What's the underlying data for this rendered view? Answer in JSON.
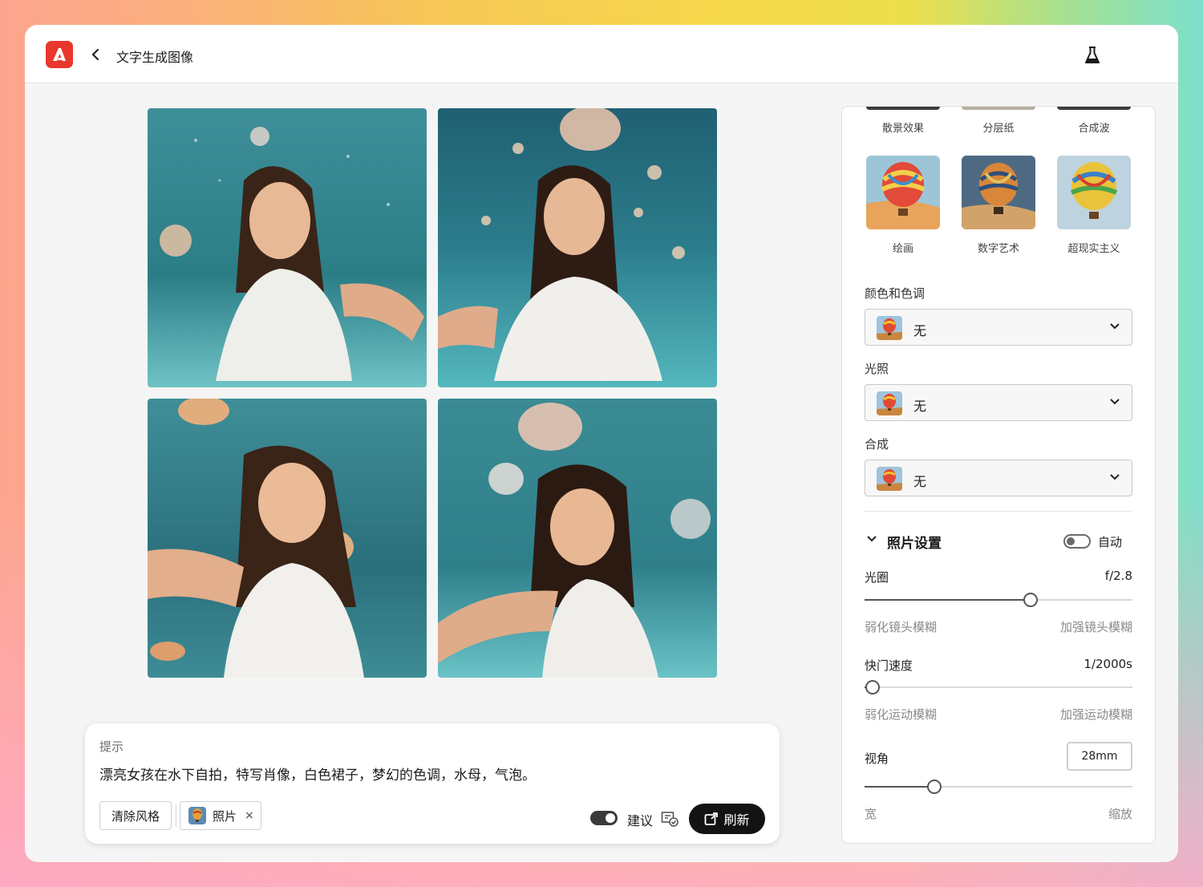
{
  "app": {
    "title": "文字生成图像",
    "logo": "adobe-firefly-logo",
    "accent": "#e8372c"
  },
  "gallery": {
    "images": [
      {
        "name": "generated-image-1"
      },
      {
        "name": "generated-image-2"
      },
      {
        "name": "generated-image-3"
      },
      {
        "name": "generated-image-4"
      }
    ]
  },
  "prompt": {
    "label": "提示",
    "text": "漂亮女孩在水下自拍，特写肖像，白色裙子，梦幻的色调，水母，气泡。",
    "clear_style_label": "清除风格",
    "style_chip_label": "照片",
    "style_chip_remove": "×",
    "suggest_label": "建议",
    "suggest_enabled": true,
    "refresh_label": "刷新"
  },
  "panel": {
    "styles_row1": [
      "散景效果",
      "分层纸",
      "合成波"
    ],
    "styles_row2": [
      "绘画",
      "数字艺术",
      "超现实主义"
    ],
    "color_tone": {
      "label": "颜色和色调",
      "value": "无"
    },
    "lighting": {
      "label": "光照",
      "value": "无"
    },
    "composition": {
      "label": "合成",
      "value": "无"
    },
    "photo_settings": {
      "title": "照片设置",
      "auto_label": "自动",
      "auto_enabled": false,
      "aperture": {
        "label": "光圈",
        "value": "f/2.8",
        "position": 0.62,
        "min_hint": "弱化镜头模糊",
        "max_hint": "加强镜头模糊"
      },
      "shutter": {
        "label": "快门速度",
        "value": "1/2000s",
        "position": 0.03,
        "min_hint": "弱化运动模糊",
        "max_hint": "加强运动模糊"
      },
      "fov": {
        "label": "视角",
        "value": "28mm",
        "position": 0.26,
        "min_hint": "宽",
        "max_hint": "缩放"
      }
    }
  }
}
